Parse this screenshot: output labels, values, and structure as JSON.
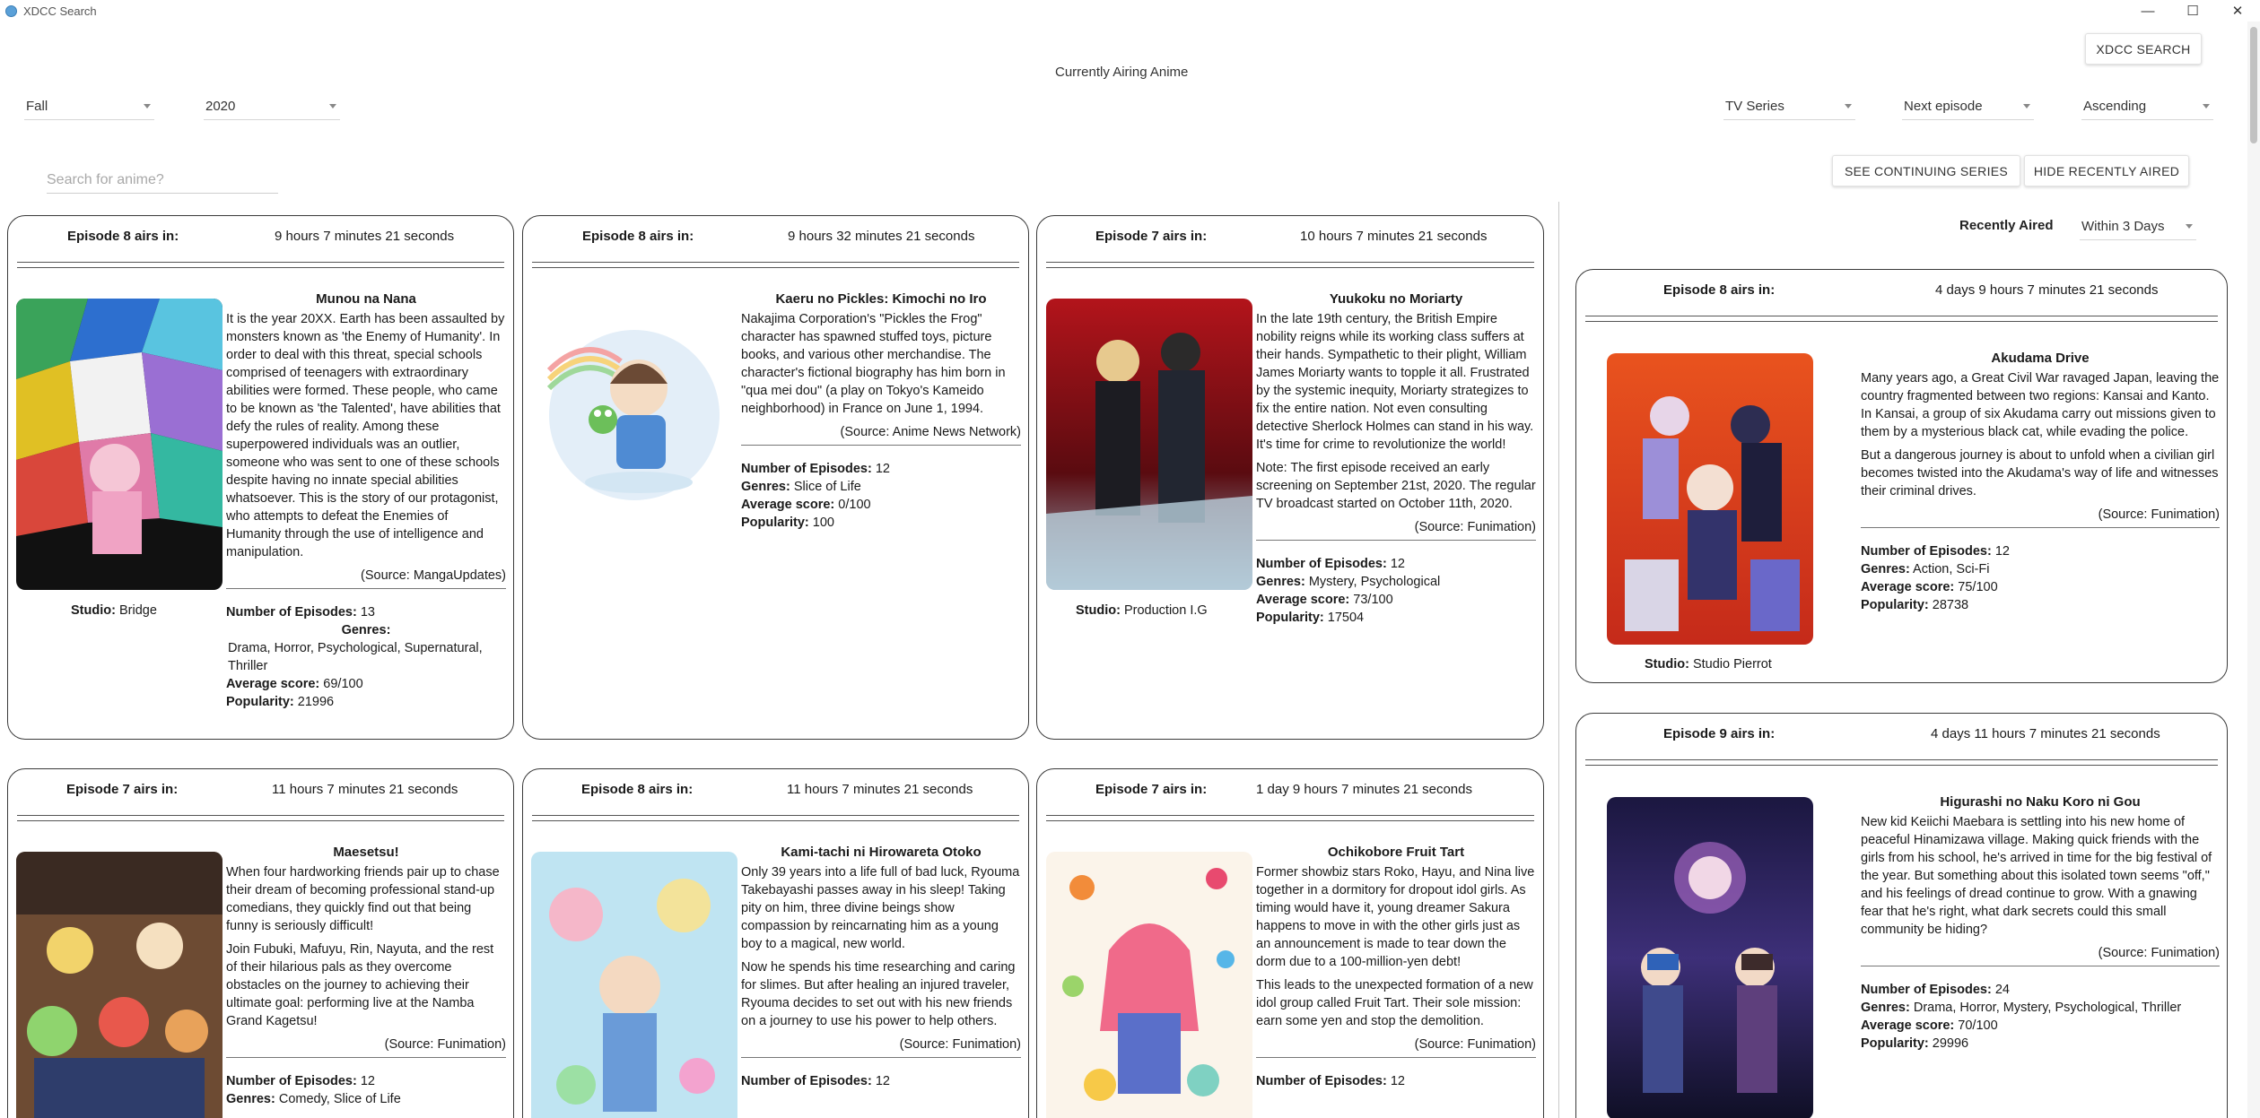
{
  "window": {
    "title": "XDCC Search",
    "minimize": "—",
    "maximize": "☐",
    "close": "✕"
  },
  "header": {
    "xdcc_button": "XDCC SEARCH",
    "heading": "Currently Airing Anime",
    "season": "Fall",
    "year": "2020",
    "format": "TV Series",
    "sort_by": "Next episode",
    "order": "Ascending",
    "search_placeholder": "Search for anime?",
    "see_continuing": "SEE CONTINUING SERIES",
    "hide_recent": "HIDE RECENTLY AIRED",
    "recently_aired_label": "Recently Aired",
    "recently_aired_range": "Within 3 Days"
  },
  "labels": {
    "studio": "Studio:",
    "episodes": "Number of Episodes:",
    "genres": "Genres:",
    "score": "Average score:",
    "popularity": "Popularity:"
  },
  "cards": [
    {
      "episode": "Episode 8 airs in:",
      "countdown": "9 hours 7 minutes 21 seconds",
      "title": "Munou na Nana",
      "description": [
        "It is the year 20XX. Earth has been assaulted by monsters known as 'the Enemy of Humanity'. In order to deal with this threat, special schools comprised of teenagers with extraordinary abilities were formed. These people, who came to be known as 'the Talented', have abilities that defy the rules of reality. Among these superpowered individuals was an outlier, someone who was sent to one of these schools despite having no innate special abilities whatsoever. This is the story of our protagonist, who attempts to defeat the Enemies of Humanity through the use of intelligence and manipulation."
      ],
      "source": "(Source: MangaUpdates)",
      "studio": "Bridge",
      "episodes": "13",
      "genres": "Drama, Horror, Psychological, Supernatural, Thriller",
      "score": "69/100",
      "popularity": "21996"
    },
    {
      "episode": "Episode 8 airs in:",
      "countdown": "9 hours 32 minutes 21 seconds",
      "title": "Kaeru no Pickles: Kimochi no Iro",
      "description": [
        "Nakajima Corporation's \"Pickles the Frog\" character has spawned stuffed toys, picture books, and various other merchandise. The character's fictional biography has him born in \"qua mei dou\" (a play on Tokyo's Kameido neighborhood) in France on June 1, 1994."
      ],
      "source": "(Source: Anime News Network)",
      "studio": "",
      "episodes": "12",
      "genres": "Slice of Life",
      "score": "0/100",
      "popularity": "100"
    },
    {
      "episode": "Episode 7 airs in:",
      "countdown": "10 hours 7 minutes 21 seconds",
      "title": "Yuukoku no Moriarty",
      "description": [
        "In the late 19th century, the British Empire nobility reigns while its working class suffers at their hands. Sympathetic to their plight, William James Moriarty wants to topple it all. Frustrated by the systemic inequity, Moriarty strategizes to fix the entire nation. Not even consulting detective Sherlock Holmes can stand in his way. It's time for crime to revolutionize the world!",
        "Note: The first episode received an early screening on September 21st, 2020. The regular TV broadcast started on October 11th, 2020."
      ],
      "source": "(Source: Funimation)",
      "studio": "Production I.G",
      "episodes": "12",
      "genres": "Mystery, Psychological",
      "score": "73/100",
      "popularity": "17504"
    },
    {
      "episode": "Episode 7 airs in:",
      "countdown": "11 hours 7 minutes 21 seconds",
      "title": "Maesetsu!",
      "description": [
        "When four hardworking friends pair up to chase their dream of becoming professional stand-up comedians, they quickly find out that being funny is seriously difficult!",
        "Join Fubuki, Mafuyu, Rin, Nayuta, and the rest of their hilarious pals as they overcome obstacles on the journey to achieving their ultimate goal: performing live at the Namba Grand Kagetsu!"
      ],
      "source": "(Source: Funimation)",
      "studio": "",
      "episodes": "12",
      "genres": "Comedy, Slice of Life",
      "score": "",
      "popularity": ""
    },
    {
      "episode": "Episode 8 airs in:",
      "countdown": "11 hours 7 minutes 21 seconds",
      "title": "Kami-tachi ni Hirowareta Otoko",
      "description": [
        "Only 39 years into a life full of bad luck, Ryouma Takebayashi passes away in his sleep! Taking pity on him, three divine beings show compassion by reincarnating him as a young boy to a magical, new world.",
        "Now he spends his time researching and caring for slimes. But after healing an injured traveler, Ryouma decides to set out with his new friends on a journey to use his power to help others."
      ],
      "source": "(Source: Funimation)",
      "studio": "",
      "episodes": "12",
      "genres": "",
      "score": "",
      "popularity": ""
    },
    {
      "episode": "Episode 7 airs in:",
      "countdown": "1 day 9 hours 7 minutes 21 seconds",
      "title": "Ochikobore Fruit Tart",
      "description": [
        "Former showbiz stars Roko, Hayu, and Nina live together in a dormitory for dropout idol girls. As timing would have it, young dreamer Sakura happens to move in with the other girls just as an announcement is made to tear down the dorm due to a 100-million-yen debt!",
        "This leads to the unexpected formation of a new idol group called Fruit Tart. Their sole mission: earn some yen and stop the demolition."
      ],
      "source": "(Source: Funimation)",
      "studio": "",
      "episodes": "12",
      "genres": "",
      "score": "",
      "popularity": ""
    },
    {
      "episode": "Episode 8 airs in:",
      "countdown": "4 days 9 hours 7 minutes 21 seconds",
      "title": "Akudama Drive",
      "description": [
        "Many years ago, a Great Civil War ravaged Japan, leaving the country fragmented between two regions: Kansai and Kanto. In Kansai, a group of six Akudama carry out missions given to them by a mysterious black cat, while evading the police.",
        "But a dangerous journey is about to unfold when a civilian girl becomes twisted into the Akudama's way of life and witnesses their criminal drives."
      ],
      "source": "(Source: Funimation)",
      "studio": "Studio Pierrot",
      "episodes": "12",
      "genres": "Action, Sci-Fi",
      "score": "75/100",
      "popularity": "28738"
    },
    {
      "episode": "Episode 9 airs in:",
      "countdown": "4 days 11 hours 7 minutes 21 seconds",
      "title": "Higurashi no Naku Koro ni Gou",
      "description": [
        "New kid Keiichi Maebara is settling into his new home of peaceful Hinamizawa village. Making quick friends with the girls from his school, he's arrived in time for the big festival of the year. But something about this isolated town seems \"off,\" and his feelings of dread continue to grow. With a gnawing fear that he's right, what dark secrets could this small community be hiding?"
      ],
      "source": "(Source: Funimation)",
      "studio": "",
      "episodes": "24",
      "genres": "Drama, Horror, Mystery, Psychological, Thriller",
      "score": "70/100",
      "popularity": "29996"
    }
  ]
}
